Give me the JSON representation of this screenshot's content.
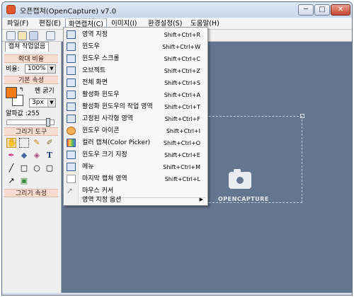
{
  "window": {
    "title": "오픈캡쳐(OpenCapture) v7.0",
    "buttons": {
      "min": "─",
      "max": "□",
      "close": "✕"
    }
  },
  "menubar": [
    {
      "label": "파일(F)"
    },
    {
      "label": "편집(E)"
    },
    {
      "label": "화면캡쳐(C)"
    },
    {
      "label": "이미지(I)"
    },
    {
      "label": "환경설정(S)"
    },
    {
      "label": "도움말(H)"
    }
  ],
  "panel": {
    "tab_label": "캡쳐 작업없음",
    "zoom_header": "확대 비율",
    "zoom_label": "비율:",
    "zoom_value": "100%",
    "basic_header": "기본 속성",
    "pen_label": "펜 굵기",
    "pen_value": "3px",
    "alpha_label": "알파값 :255",
    "alpha_level": 1.0,
    "draw_tools_header": "그리기 도구",
    "draw_props_header": "그리기 속성",
    "colors": {
      "foreground": "#f27a17",
      "background": "#ffffff"
    }
  },
  "canvas": {
    "logo_text": "OPENCAPTURE",
    "background": "#64758e"
  },
  "capture_menu": [
    {
      "label": "영역 지정",
      "shortcut": "Shift+Ctrl+R",
      "icon": "region-icon"
    },
    {
      "label": "윈도우",
      "shortcut": "Shift+Ctrl+W",
      "icon": "window-icon"
    },
    {
      "label": "윈도우 스크롤",
      "shortcut": "Shift+Ctrl+C",
      "icon": "scroll-window-icon"
    },
    {
      "label": "오브젝트",
      "shortcut": "Shift+Ctrl+Z",
      "icon": "object-icon"
    },
    {
      "label": "전체 화면",
      "shortcut": "Shift+Ctrl+S",
      "icon": "fullscreen-icon"
    },
    {
      "label": "활성화 윈도우",
      "shortcut": "Shift+Ctrl+A",
      "icon": "active-window-icon"
    },
    {
      "label": "활성화 윈도우의 작업 영역",
      "shortcut": "Shift+Ctrl+T",
      "icon": "client-area-icon"
    },
    {
      "label": "고정된 사각형 영역",
      "shortcut": "Shift+Ctrl+F",
      "icon": "fixed-rect-icon"
    },
    {
      "label": "윈도우 아이콘",
      "shortcut": "Shift+Ctrl+I",
      "icon": "window-icon-capture-icon"
    },
    {
      "label": "컬러 캡쳐(Color Picker)",
      "shortcut": "Shift+Ctrl+O",
      "icon": "color-picker-icon"
    },
    {
      "label": "윈도우 크기 지정",
      "shortcut": "Shift+Ctrl+E",
      "icon": "window-size-icon"
    },
    {
      "label": "메뉴",
      "shortcut": "Shift+Ctrl+M",
      "icon": "menu-capture-icon"
    },
    {
      "label": "마지막 캡쳐 영역",
      "shortcut": "Shift+Ctrl+L",
      "icon": "last-region-icon"
    },
    {
      "label": "마우스 커서",
      "shortcut": "",
      "icon": "cursor-icon"
    }
  ],
  "capture_menu_sub": {
    "label": "영역 지정 옵션",
    "arrow": "▶"
  }
}
